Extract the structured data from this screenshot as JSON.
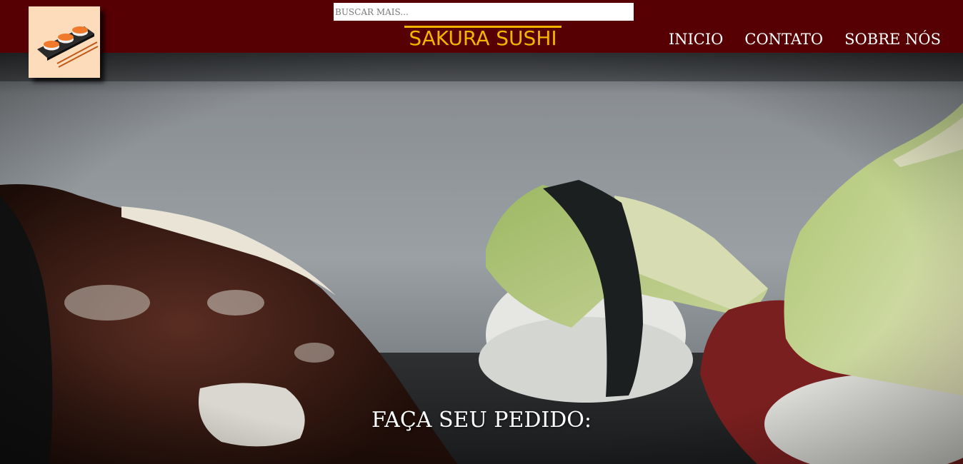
{
  "header": {
    "search_placeholder": "BUSCAR MAIS...",
    "brand": "SAKURA SUSHI",
    "nav": [
      {
        "label": "INICIO"
      },
      {
        "label": "CONTATO"
      },
      {
        "label": "SOBRE NÓS"
      }
    ],
    "logo_icon": "sushi-tray-icon"
  },
  "hero": {
    "caption": "FAÇA SEU PEDIDO:",
    "image": "sushi-photo"
  },
  "colors": {
    "header_bg": "#560003",
    "brand": "#f4b400",
    "logo_bg": "#fddcbb",
    "nav_text": "#ffffff"
  }
}
